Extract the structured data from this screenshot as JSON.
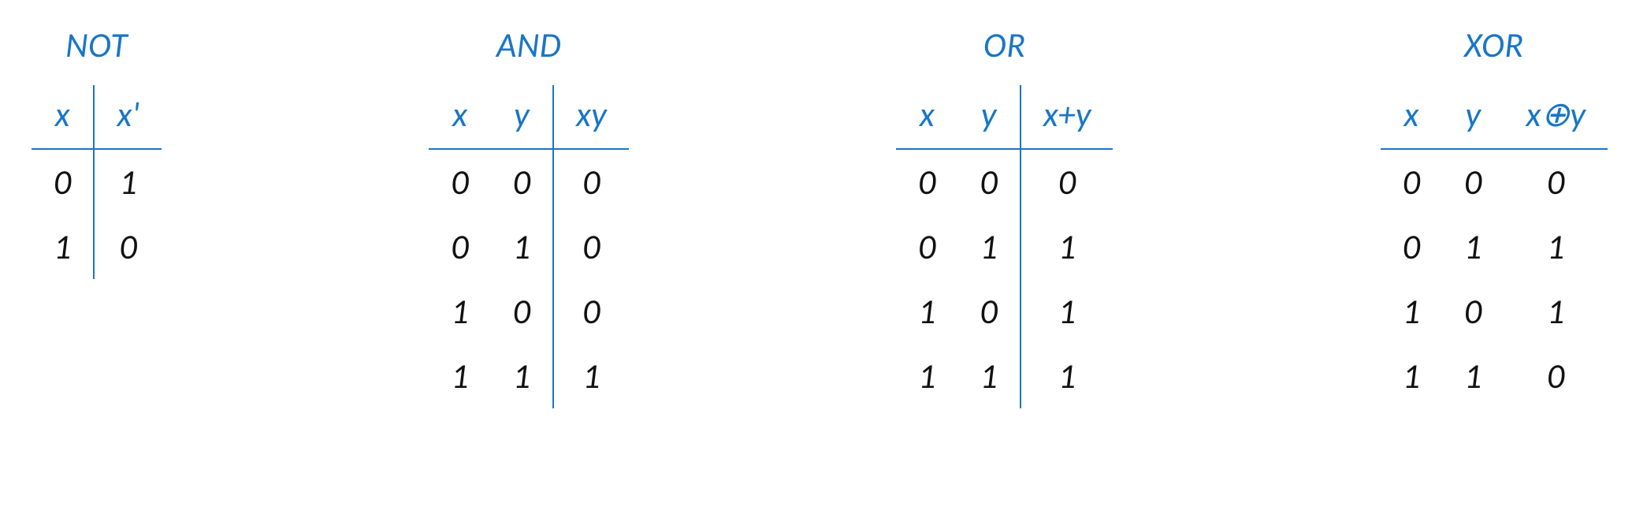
{
  "colors": {
    "accent": "#1976c8",
    "text": "#111"
  },
  "tables": {
    "not": {
      "title": "NOT",
      "headers": [
        "x",
        "x'"
      ],
      "sep_after_col": 0,
      "rows": [
        [
          "0",
          "1"
        ],
        [
          "1",
          "0"
        ]
      ]
    },
    "and": {
      "title": "AND",
      "headers": [
        "x",
        "y",
        "xy"
      ],
      "sep_after_col": 1,
      "rows": [
        [
          "0",
          "0",
          "0"
        ],
        [
          "0",
          "1",
          "0"
        ],
        [
          "1",
          "0",
          "0"
        ],
        [
          "1",
          "1",
          "1"
        ]
      ]
    },
    "or": {
      "title": "OR",
      "headers": [
        "x",
        "y",
        "x+y"
      ],
      "sep_after_col": 1,
      "rows": [
        [
          "0",
          "0",
          "0"
        ],
        [
          "0",
          "1",
          "1"
        ],
        [
          "1",
          "0",
          "1"
        ],
        [
          "1",
          "1",
          "1"
        ]
      ]
    },
    "xor": {
      "title": "XOR",
      "headers": [
        "x",
        "y",
        "x⊕y"
      ],
      "sep_after_col": -1,
      "rows": [
        [
          "0",
          "0",
          "0"
        ],
        [
          "0",
          "1",
          "1"
        ],
        [
          "1",
          "0",
          "1"
        ],
        [
          "1",
          "1",
          "0"
        ]
      ]
    }
  }
}
